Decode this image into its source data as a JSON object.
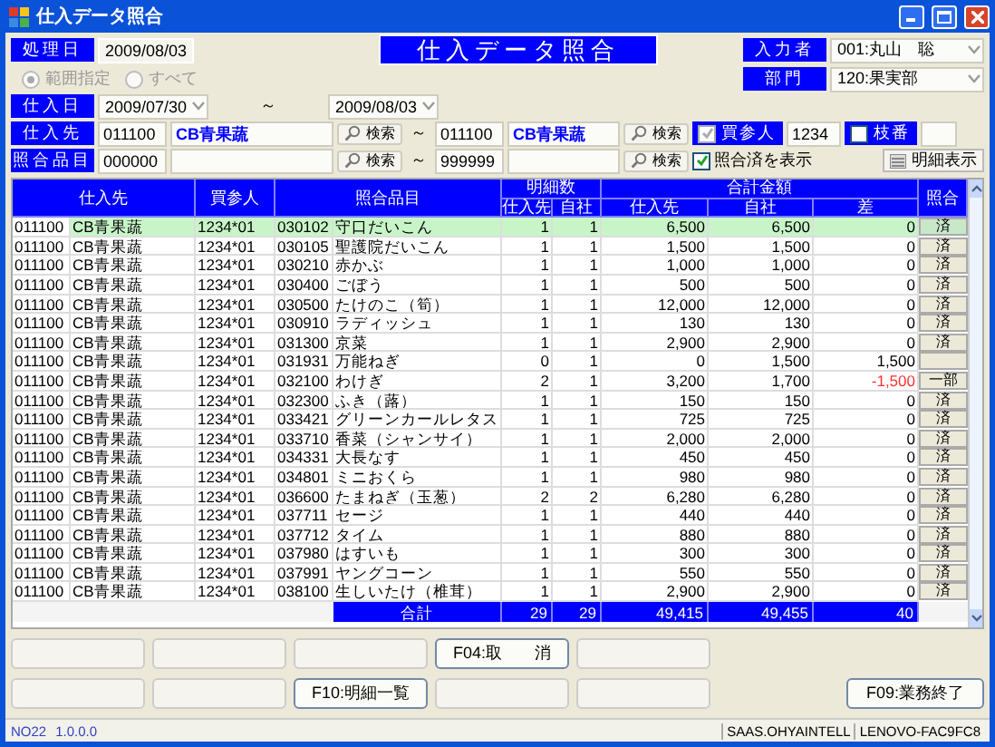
{
  "window": {
    "title": "仕入データ照合"
  },
  "header": {
    "date_label": "処理日",
    "date_value": "2009/08/03",
    "screen_title": "仕入データ照合",
    "user_label": "入力者",
    "user_value": "001:丸山　聡",
    "dept_label": "部門",
    "dept_value": "120:果実部"
  },
  "range": [
    {
      "label": "範囲指定",
      "selected": true
    },
    {
      "label": "すべて",
      "selected": false
    }
  ],
  "period": {
    "label": "仕入日",
    "from": "2009/07/30",
    "sep": "～",
    "to": "2009/08/03"
  },
  "supplier": {
    "label": "仕入先",
    "from_code": "011100",
    "from_name": "CB青果蔬",
    "search": "検索",
    "sep": "～",
    "to_code": "011100",
    "to_name": "CB青果蔬",
    "search2": "検索"
  },
  "buyer": {
    "label": "買参人",
    "checked": true,
    "value": "1234"
  },
  "branch": {
    "label": "枝番",
    "checked": false
  },
  "item": {
    "label": "照合品目",
    "from_code": "000000",
    "search": "検索",
    "sep": "～",
    "to_code": "999999",
    "search2": "検索"
  },
  "show_matched": {
    "label": "照合済を表示",
    "checked": true
  },
  "detail_button": "明細表示",
  "table": {
    "columns": {
      "supplier": "仕入先",
      "buyer": "買参人",
      "item": "照合品目",
      "count": "明細数",
      "count_supplier": "仕入先",
      "count_own": "自社",
      "amount": "合計金額",
      "amount_supplier": "仕入先",
      "amount_own": "自社",
      "diff": "差",
      "match": "照合"
    },
    "rows": [
      {
        "sc": "011100",
        "sn": "CB青果蔬",
        "buyer": "1234*01",
        "ic": "030102",
        "in": "守口だいこん",
        "n1": "1",
        "n2": "1",
        "a1": "6,500",
        "a2": "6,500",
        "diff": "0",
        "negative": false,
        "match": "済",
        "selected": true
      },
      {
        "sc": "011100",
        "sn": "CB青果蔬",
        "buyer": "1234*01",
        "ic": "030105",
        "in": "聖護院だいこん",
        "n1": "1",
        "n2": "1",
        "a1": "1,500",
        "a2": "1,500",
        "diff": "0",
        "negative": false,
        "match": "済",
        "selected": false
      },
      {
        "sc": "011100",
        "sn": "CB青果蔬",
        "buyer": "1234*01",
        "ic": "030210",
        "in": "赤かぶ",
        "n1": "1",
        "n2": "1",
        "a1": "1,000",
        "a2": "1,000",
        "diff": "0",
        "negative": false,
        "match": "済",
        "selected": false
      },
      {
        "sc": "011100",
        "sn": "CB青果蔬",
        "buyer": "1234*01",
        "ic": "030400",
        "in": "ごぼう",
        "n1": "1",
        "n2": "1",
        "a1": "500",
        "a2": "500",
        "diff": "0",
        "negative": false,
        "match": "済",
        "selected": false
      },
      {
        "sc": "011100",
        "sn": "CB青果蔬",
        "buyer": "1234*01",
        "ic": "030500",
        "in": "たけのこ（筍）",
        "n1": "1",
        "n2": "1",
        "a1": "12,000",
        "a2": "12,000",
        "diff": "0",
        "negative": false,
        "match": "済",
        "selected": false
      },
      {
        "sc": "011100",
        "sn": "CB青果蔬",
        "buyer": "1234*01",
        "ic": "030910",
        "in": "ラディッシュ",
        "n1": "1",
        "n2": "1",
        "a1": "130",
        "a2": "130",
        "diff": "0",
        "negative": false,
        "match": "済",
        "selected": false
      },
      {
        "sc": "011100",
        "sn": "CB青果蔬",
        "buyer": "1234*01",
        "ic": "031300",
        "in": "京菜",
        "n1": "1",
        "n2": "1",
        "a1": "2,900",
        "a2": "2,900",
        "diff": "0",
        "negative": false,
        "match": "済",
        "selected": false
      },
      {
        "sc": "011100",
        "sn": "CB青果蔬",
        "buyer": "1234*01",
        "ic": "031931",
        "in": "万能ねぎ",
        "n1": "0",
        "n2": "1",
        "a1": "0",
        "a2": "1,500",
        "diff": "1,500",
        "negative": false,
        "selected": false
      },
      {
        "sc": "011100",
        "sn": "CB青果蔬",
        "buyer": "1234*01",
        "ic": "032100",
        "in": "わけぎ",
        "n1": "2",
        "n2": "1",
        "a1": "3,200",
        "a2": "1,700",
        "diff": "-1,500",
        "negative": true,
        "match": "一部",
        "selected": false
      },
      {
        "sc": "011100",
        "sn": "CB青果蔬",
        "buyer": "1234*01",
        "ic": "032300",
        "in": "ふき（蕗）",
        "n1": "1",
        "n2": "1",
        "a1": "150",
        "a2": "150",
        "diff": "0",
        "negative": false,
        "match": "済",
        "selected": false
      },
      {
        "sc": "011100",
        "sn": "CB青果蔬",
        "buyer": "1234*01",
        "ic": "033421",
        "in": "グリーンカールレタス",
        "n1": "1",
        "n2": "1",
        "a1": "725",
        "a2": "725",
        "diff": "0",
        "negative": false,
        "match": "済",
        "selected": false
      },
      {
        "sc": "011100",
        "sn": "CB青果蔬",
        "buyer": "1234*01",
        "ic": "033710",
        "in": "香菜（シャンサイ）",
        "n1": "1",
        "n2": "1",
        "a1": "2,000",
        "a2": "2,000",
        "diff": "0",
        "negative": false,
        "match": "済",
        "selected": false
      },
      {
        "sc": "011100",
        "sn": "CB青果蔬",
        "buyer": "1234*01",
        "ic": "034331",
        "in": "大長なす",
        "n1": "1",
        "n2": "1",
        "a1": "450",
        "a2": "450",
        "diff": "0",
        "negative": false,
        "match": "済",
        "selected": false
      },
      {
        "sc": "011100",
        "sn": "CB青果蔬",
        "buyer": "1234*01",
        "ic": "034801",
        "in": "ミニおくら",
        "n1": "1",
        "n2": "1",
        "a1": "980",
        "a2": "980",
        "diff": "0",
        "negative": false,
        "match": "済",
        "selected": false
      },
      {
        "sc": "011100",
        "sn": "CB青果蔬",
        "buyer": "1234*01",
        "ic": "036600",
        "in": "たまねぎ（玉葱）",
        "n1": "2",
        "n2": "2",
        "a1": "6,280",
        "a2": "6,280",
        "diff": "0",
        "negative": false,
        "match": "済",
        "selected": false
      },
      {
        "sc": "011100",
        "sn": "CB青果蔬",
        "buyer": "1234*01",
        "ic": "037711",
        "in": "セージ",
        "n1": "1",
        "n2": "1",
        "a1": "440",
        "a2": "440",
        "diff": "0",
        "negative": false,
        "match": "済",
        "selected": false
      },
      {
        "sc": "011100",
        "sn": "CB青果蔬",
        "buyer": "1234*01",
        "ic": "037712",
        "in": "タイム",
        "n1": "1",
        "n2": "1",
        "a1": "880",
        "a2": "880",
        "diff": "0",
        "negative": false,
        "match": "済",
        "selected": false
      },
      {
        "sc": "011100",
        "sn": "CB青果蔬",
        "buyer": "1234*01",
        "ic": "037980",
        "in": "はすいも",
        "n1": "1",
        "n2": "1",
        "a1": "300",
        "a2": "300",
        "diff": "0",
        "negative": false,
        "match": "済",
        "selected": false
      },
      {
        "sc": "011100",
        "sn": "CB青果蔬",
        "buyer": "1234*01",
        "ic": "037991",
        "in": "ヤングコーン",
        "n1": "1",
        "n2": "1",
        "a1": "550",
        "a2": "550",
        "diff": "0",
        "negative": false,
        "match": "済",
        "selected": false
      },
      {
        "sc": "011100",
        "sn": "CB青果蔬",
        "buyer": "1234*01",
        "ic": "038100",
        "in": "生しいたけ（椎茸）",
        "n1": "1",
        "n2": "1",
        "a1": "2,900",
        "a2": "2,900",
        "diff": "0",
        "negative": false,
        "match": "済",
        "selected": false
      }
    ],
    "totals": {
      "label": "合計",
      "n1": "29",
      "n2": "29",
      "a1": "49,415",
      "a2": "49,455",
      "diff": "40"
    }
  },
  "function_keys": [
    [
      {
        "kind": "blank"
      },
      {
        "kind": "blank"
      },
      {
        "kind": "blank"
      },
      {
        "kind": "key",
        "label": "F04:取　　消"
      },
      {
        "kind": "blank"
      }
    ],
    [
      {
        "kind": "blank"
      },
      {
        "kind": "blank"
      },
      {
        "kind": "key",
        "label": "F10:明細一覧"
      },
      {
        "kind": "blank"
      },
      {
        "kind": "blank"
      }
    ]
  ],
  "exit_button": "F09:業務終了",
  "status_bar": {
    "id": "NO22",
    "version": "1.0.0.0",
    "server": "SAAS.OHYAINTELL",
    "machine": "LENOVO-FAC9FC8"
  }
}
